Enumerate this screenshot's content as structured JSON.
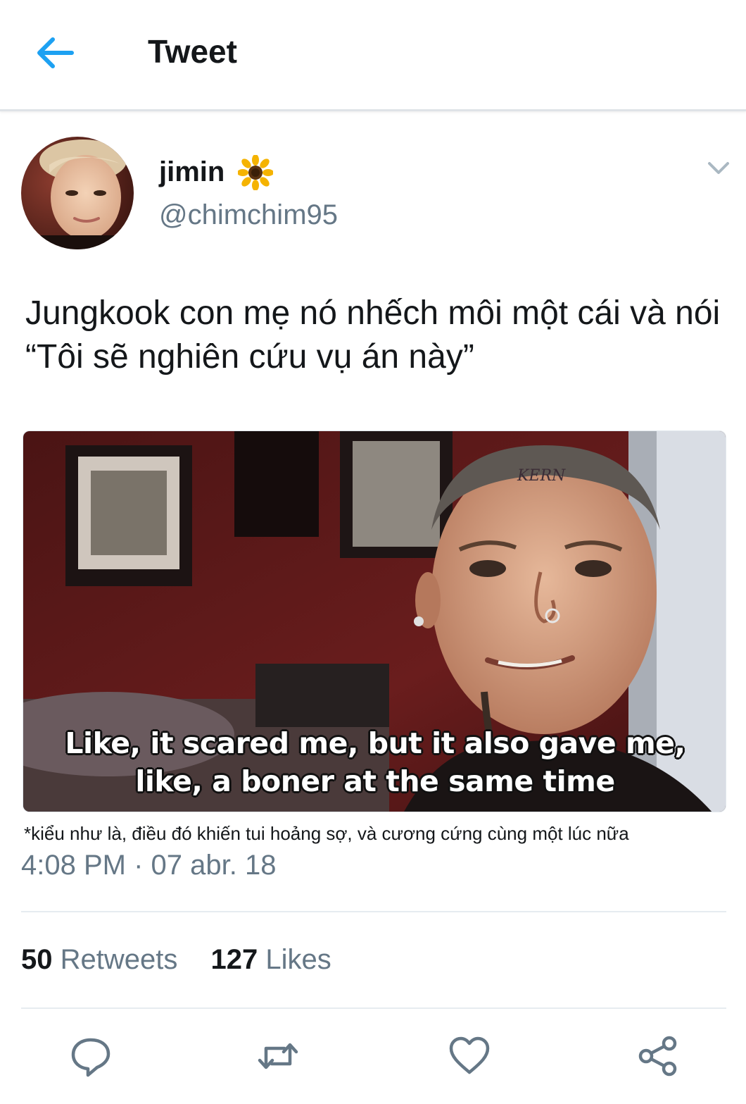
{
  "header": {
    "title": "Tweet"
  },
  "user": {
    "display_name": "jimin",
    "handle": "@chimchim95"
  },
  "tweet": {
    "text": "Jungkook con mẹ nó nhếch môi một cái và nói “Tôi sẽ nghiên cứu vụ án này”",
    "media_subtitle": [
      "Like, it scared me, but it also gave me,",
      "like, a boner at the same time"
    ],
    "translation": "*kiểu như là, điều đó khiến tui hoảng sợ, và cương cứng cùng một lúc nữa",
    "timestamp": "4:08 PM · 07 abr. 18"
  },
  "stats": {
    "retweets_count": "50",
    "retweets_label": "Retweets",
    "likes_count": "127",
    "likes_label": "Likes"
  },
  "icons": {
    "back": "arrow-left-icon",
    "verified_emoji": "sunflower-icon",
    "more": "chevron-down-icon",
    "reply": "reply-icon",
    "retweet": "retweet-icon",
    "like": "heart-icon",
    "share": "share-icon"
  },
  "colors": {
    "accent": "#1da1f2",
    "secondary_text": "#657786",
    "icon_gray": "#657786"
  }
}
